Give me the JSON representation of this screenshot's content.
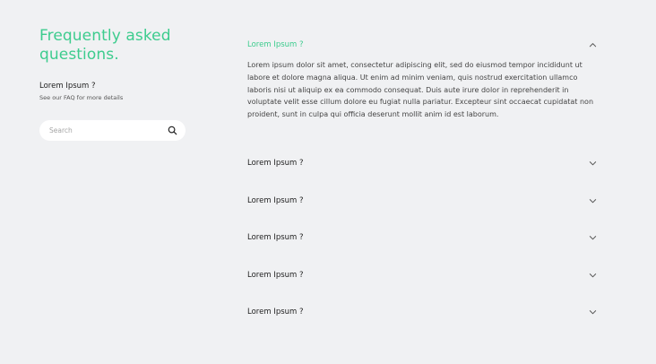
{
  "sidebar": {
    "title": "Frequently asked questions.",
    "subhead": "Lorem Ipsum ?",
    "subtext": "See our FAQ for more details",
    "search": {
      "placeholder": "Search",
      "icon": "search-icon"
    }
  },
  "faq": {
    "accent_color": "#3dcc8e",
    "open_item": {
      "question": "Lorem Ipsum ?",
      "answer": "Lorem ipsum dolor sit amet, consectetur adipiscing elit, sed do eiusmod tempor incididunt ut labore et dolore magna aliqua. Ut enim ad minim veniam, quis nostrud exercitation ullamco laboris nisi ut aliquip ex ea commodo consequat. Duis aute irure dolor in reprehenderit in voluptate velit esse cillum dolore eu fugiat nulla pariatur. Excepteur sint occaecat cupidatat non proident, sunt in culpa qui officia deserunt mollit anim id est laborum.",
      "icon": "chevron-up-icon"
    },
    "items": [
      {
        "question": "Lorem Ipsum ?",
        "icon": "chevron-down-icon"
      },
      {
        "question": "Lorem Ipsum ?",
        "icon": "chevron-down-icon"
      },
      {
        "question": "Lorem Ipsum ?",
        "icon": "chevron-down-icon"
      },
      {
        "question": "Lorem Ipsum ?",
        "icon": "chevron-down-icon"
      },
      {
        "question": "Lorem Ipsum ?",
        "icon": "chevron-down-icon"
      }
    ]
  }
}
